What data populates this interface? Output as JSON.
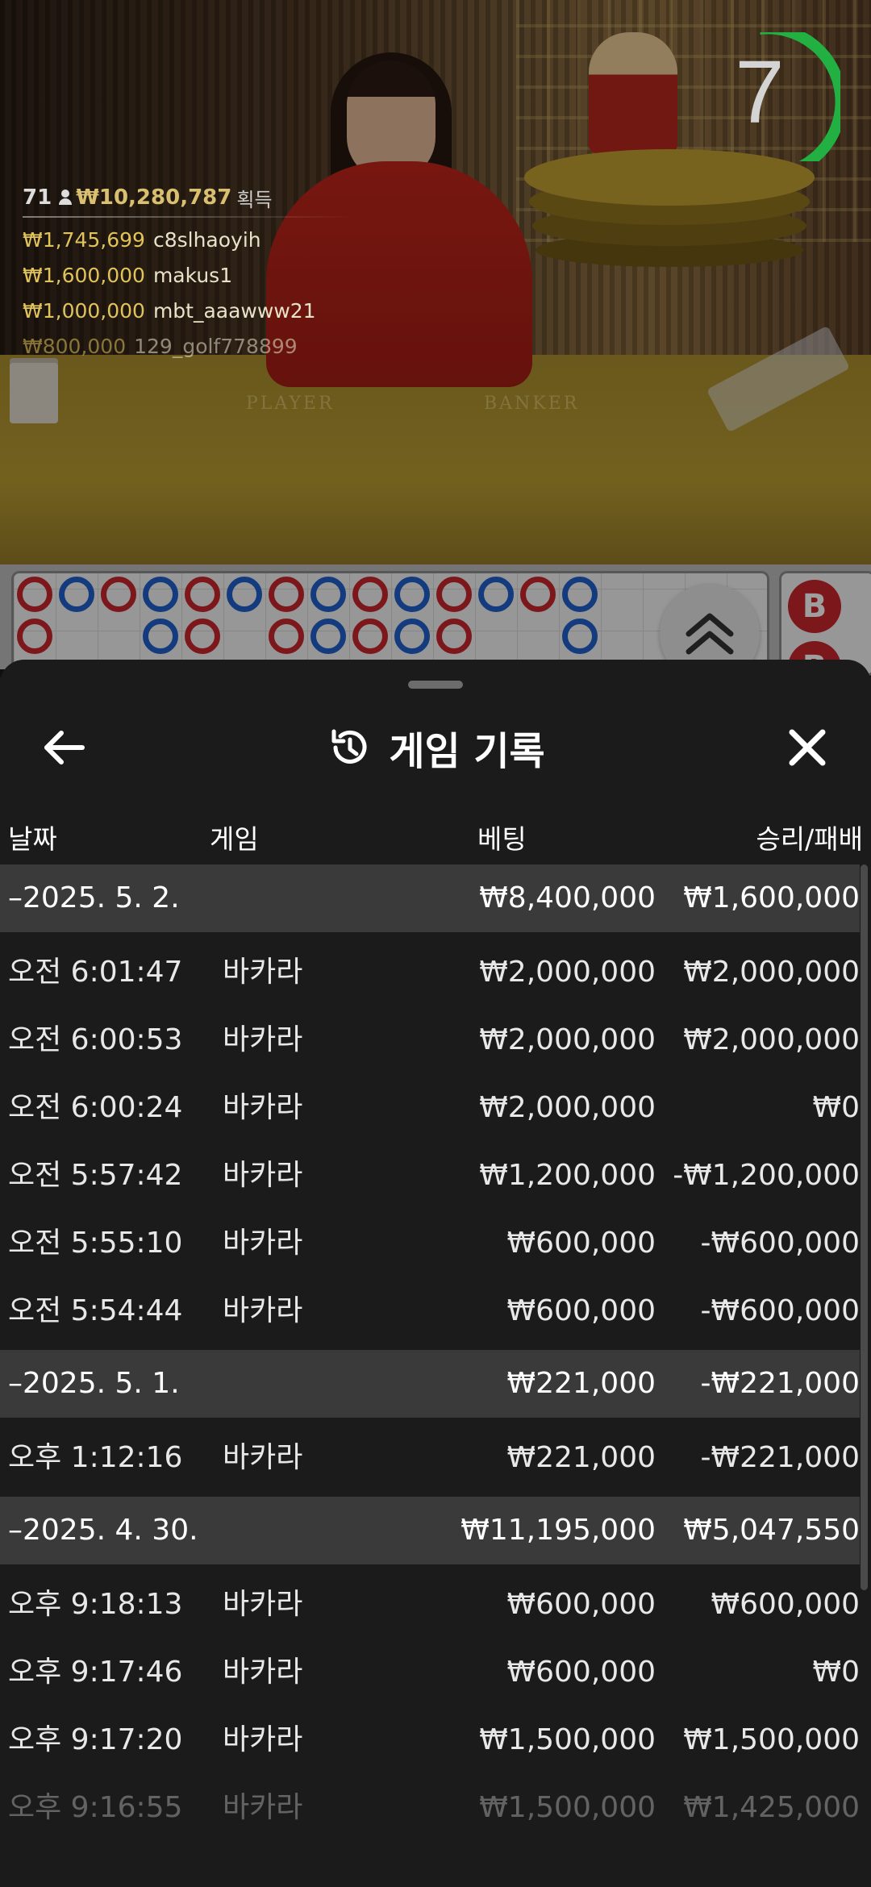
{
  "stream": {
    "countdown": "7",
    "felt_left": "PLAYER",
    "felt_right": "BANKER",
    "winners_count": "71",
    "winners_total": "₩10,280,787",
    "winners_suffix": "획득",
    "winners": [
      {
        "amount": "₩1,745,699",
        "user": "c8slhaoyih"
      },
      {
        "amount": "₩1,600,000",
        "user": "makus1"
      },
      {
        "amount": "₩1,000,000",
        "user": "mbt_aaawww21"
      },
      {
        "amount": "₩800,000",
        "user": "129_golf778899"
      }
    ],
    "road_badge_1": "B",
    "road_badge_2": "B"
  },
  "sheet": {
    "title": "게임 기록",
    "icons": {
      "back": "arrow-left-icon",
      "close": "close-icon",
      "title": "history-icon",
      "expand": "chevron-double-up-icon"
    }
  },
  "columns": {
    "date": "날짜",
    "game": "게임",
    "bet": "베팅",
    "result": "승리/패배"
  },
  "history": [
    {
      "type": "day",
      "date": "–2025. 5. 2.",
      "bet": "₩8,400,000",
      "result": "₩1,600,000"
    },
    {
      "type": "game",
      "time": "오전 6:01:47",
      "game": "바카라",
      "bet": "₩2,000,000",
      "result": "₩2,000,000"
    },
    {
      "type": "game",
      "time": "오전 6:00:53",
      "game": "바카라",
      "bet": "₩2,000,000",
      "result": "₩2,000,000"
    },
    {
      "type": "game",
      "time": "오전 6:00:24",
      "game": "바카라",
      "bet": "₩2,000,000",
      "result": "₩0"
    },
    {
      "type": "game",
      "time": "오전 5:57:42",
      "game": "바카라",
      "bet": "₩1,200,000",
      "result": "-₩1,200,000"
    },
    {
      "type": "game",
      "time": "오전 5:55:10",
      "game": "바카라",
      "bet": "₩600,000",
      "result": "-₩600,000"
    },
    {
      "type": "game",
      "time": "오전 5:54:44",
      "game": "바카라",
      "bet": "₩600,000",
      "result": "-₩600,000"
    },
    {
      "type": "day",
      "date": "–2025. 5. 1.",
      "bet": "₩221,000",
      "result": "-₩221,000"
    },
    {
      "type": "game",
      "time": "오후 1:12:16",
      "game": "바카라",
      "bet": "₩221,000",
      "result": "-₩221,000"
    },
    {
      "type": "day",
      "date": "–2025. 4. 30.",
      "bet": "₩11,195,000",
      "result": "₩5,047,550"
    },
    {
      "type": "game",
      "time": "오후 9:18:13",
      "game": "바카라",
      "bet": "₩600,000",
      "result": "₩600,000"
    },
    {
      "type": "game",
      "time": "오후 9:17:46",
      "game": "바카라",
      "bet": "₩600,000",
      "result": "₩0"
    },
    {
      "type": "game",
      "time": "오후 9:17:20",
      "game": "바카라",
      "bet": "₩1,500,000",
      "result": "₩1,500,000"
    },
    {
      "type": "game",
      "time": "오후 9:16:55",
      "game": "바카라",
      "bet": "₩1,500,000",
      "result": "₩1,425,000"
    }
  ]
}
